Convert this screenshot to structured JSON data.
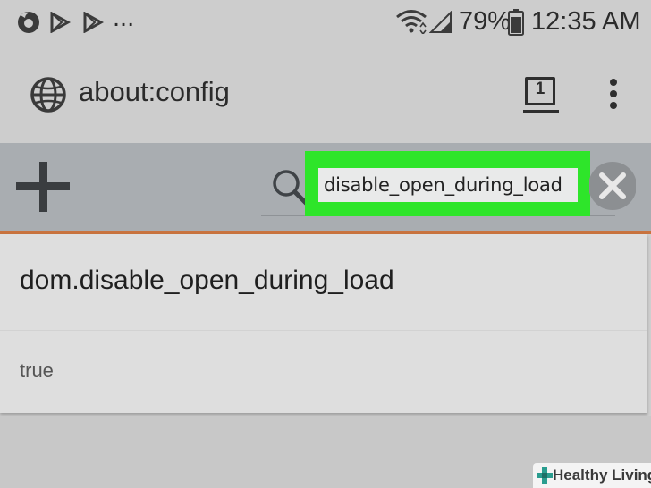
{
  "status_bar": {
    "notification_icons": [
      "firefox-icon",
      "play-store-icon",
      "play-store-icon"
    ],
    "overflow": "...",
    "battery_percent": "79%",
    "time": "12:35 AM"
  },
  "url_bar": {
    "url": "about:config",
    "tab_count": "1",
    "menu_icon": "more-vertical-icon"
  },
  "toolbar": {
    "search_value": "disable_open_during_load",
    "highlight_color": "#2ee52a"
  },
  "pref": {
    "name": "dom.disable_open_during_load",
    "value": "true"
  },
  "watermark": {
    "text": "Healthy Living"
  },
  "colors": {
    "accent_line": "#c9733e",
    "toolbar_bg": "#a9adb1"
  }
}
